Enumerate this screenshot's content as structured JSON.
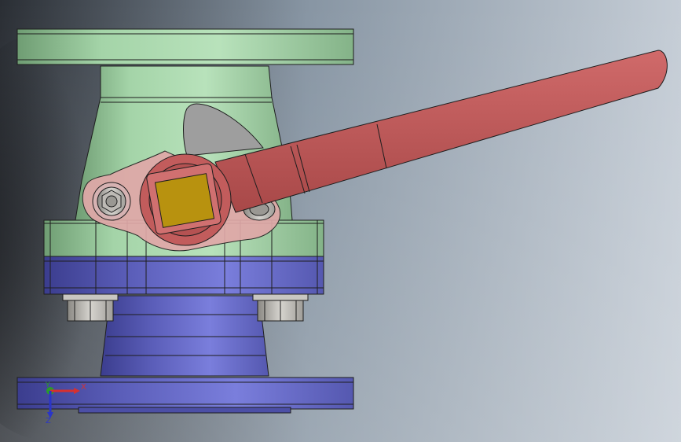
{
  "viewport": {
    "background_colors": [
      "#2a2e34",
      "#8795a3",
      "#c5cdd6"
    ]
  },
  "part_colors": {
    "upper_body": "#a4d4a8",
    "lower_body": "#6a6dc8",
    "handle": "#c25c5c",
    "stem": "#b8920f",
    "plate": "#e0a8a8",
    "bolt": "#c9c7c2",
    "stop": "#9e9e9e",
    "edge": "#1e1e1e"
  },
  "triad": {
    "x_label": "X",
    "y_label": "Y",
    "z_label": "Z",
    "x_color": "#d63030",
    "y_color": "#2a9c2a",
    "z_color": "#2a35c8"
  }
}
